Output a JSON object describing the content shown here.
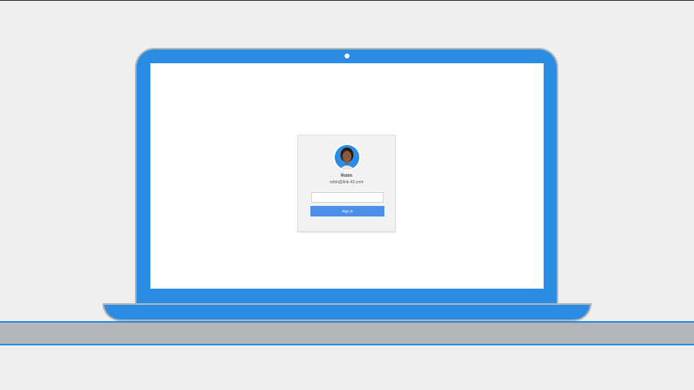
{
  "login": {
    "user_name": "Robin",
    "user_email": "robin@link-42.com",
    "password_value": "",
    "password_placeholder": "",
    "signin_label": "Sign in"
  },
  "colors": {
    "laptop_blue": "#2b8ce3",
    "laptop_border": "#b4b4b4",
    "desk_gray": "#b4b6b8",
    "background": "#efefef",
    "signin_button": "#4d8fe8"
  },
  "icons": {
    "avatar": "user-avatar-photo",
    "camera": "webcam-dot"
  }
}
